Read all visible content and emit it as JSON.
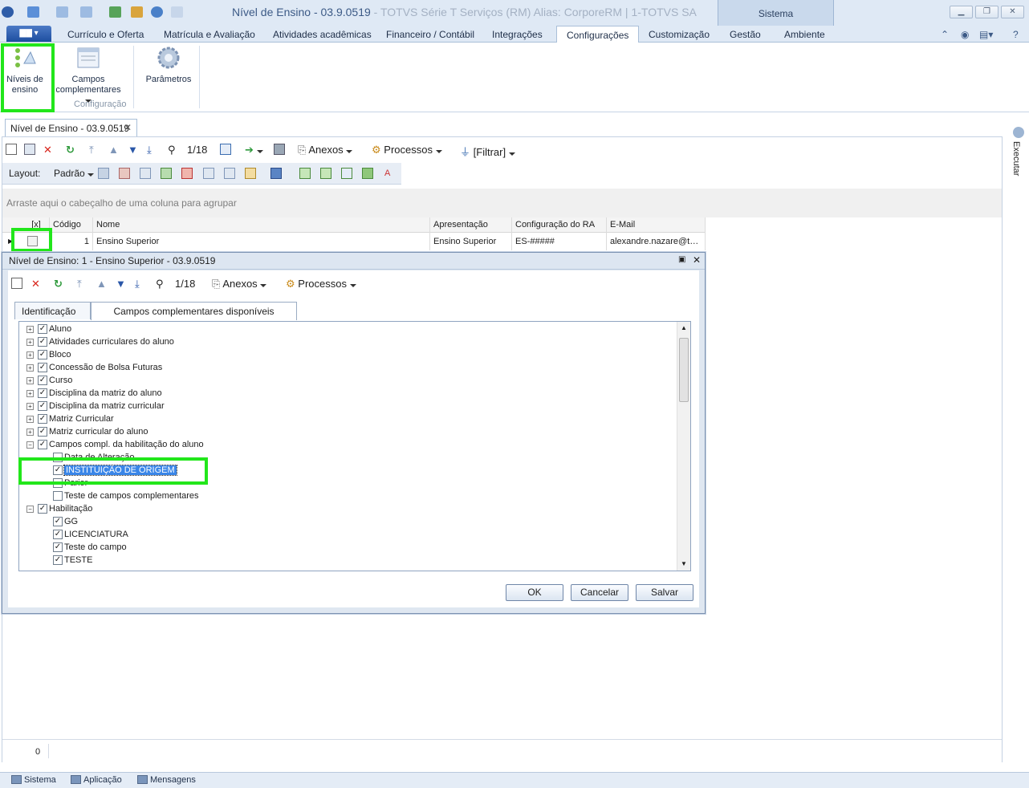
{
  "window": {
    "title_main": "Nível de Ensino - 03.9.0519",
    "title_sub": " - TOTVS Série T Serviços (RM) Alias: CorporeRM | 1-TOTVS SA",
    "sistema_label": "Sistema"
  },
  "menu": {
    "tabs": [
      "Currículo e Oferta",
      "Matrícula e Avaliação",
      "Atividades acadêmicas",
      "Financeiro / Contábil",
      "Integrações",
      "Configurações",
      "Customização",
      "Gestão",
      "Ambiente"
    ],
    "active": "Configurações"
  },
  "ribbon": {
    "niveis_label_1": "Níveis de",
    "niveis_label_2": "ensino",
    "campos_label_1": "Campos",
    "campos_label_2": "complementares",
    "group_label": "Configuração",
    "parametros_label": "Parâmetros"
  },
  "doc_tab": {
    "label": "Nível de Ensino - 03.9.0519"
  },
  "toolbar": {
    "record_counter": "1/18",
    "anexos": "Anexos",
    "processos": "Processos",
    "filtrar": "[Filtrar]"
  },
  "layoutbar": {
    "label": "Layout:",
    "padrao": "Padrão"
  },
  "grid": {
    "group_hint": "Arraste aqui o cabeçalho de uma coluna para agrupar",
    "columns": [
      "[x]",
      "Código",
      "Nome",
      "Apresentação",
      "Configuração do RA",
      "E-Mail"
    ],
    "rows": [
      {
        "codigo": "1",
        "nome": "Ensino Superior",
        "apresentacao": "Ensino Superior",
        "config_ra": "ES-#####",
        "email": "alexandre.nazare@t…"
      }
    ],
    "count": "0"
  },
  "side_panel": {
    "label": "Executar"
  },
  "dialog": {
    "title": "Nível de Ensino: 1 - Ensino Superior - 03.9.0519",
    "record_counter": "1/18",
    "anexos": "Anexos",
    "processos": "Processos",
    "tabs": [
      "Identificação",
      "Campos complementares disponíveis"
    ],
    "active_tab": "Campos complementares disponíveis",
    "tree": [
      {
        "label": "Aluno",
        "level": 0,
        "expander": "+",
        "checked": true
      },
      {
        "label": "Atividades curriculares do aluno",
        "level": 0,
        "expander": "+",
        "checked": true
      },
      {
        "label": "Bloco",
        "level": 0,
        "expander": "+",
        "checked": true
      },
      {
        "label": "Concessão de Bolsa Futuras",
        "level": 0,
        "expander": "+",
        "checked": true
      },
      {
        "label": "Curso",
        "level": 0,
        "expander": "+",
        "checked": true
      },
      {
        "label": "Disciplina da matriz do aluno",
        "level": 0,
        "expander": "+",
        "checked": true
      },
      {
        "label": "Disciplina da matriz curricular",
        "level": 0,
        "expander": "+",
        "checked": true
      },
      {
        "label": "Matriz Curricular",
        "level": 0,
        "expander": "+",
        "checked": true
      },
      {
        "label": "Matriz curricular do aluno",
        "level": 0,
        "expander": "+",
        "checked": true
      },
      {
        "label": "Campos compl. da habilitação do aluno",
        "level": 0,
        "expander": "−",
        "checked": true
      },
      {
        "label": "Data de Alteração",
        "level": 1,
        "expander": "",
        "checked": false
      },
      {
        "label": "INSTITUIÇÃO DE ORIGEM",
        "level": 1,
        "expander": "",
        "checked": true,
        "selected": true
      },
      {
        "label": "Parior",
        "level": 1,
        "expander": "",
        "checked": false
      },
      {
        "label": "Teste de campos complementares",
        "level": 1,
        "expander": "",
        "checked": false
      },
      {
        "label": "Habilitação",
        "level": 0,
        "expander": "−",
        "checked": true
      },
      {
        "label": "GG",
        "level": 1,
        "expander": "",
        "checked": true
      },
      {
        "label": "LICENCIATURA",
        "level": 1,
        "expander": "",
        "checked": true
      },
      {
        "label": "Teste do campo",
        "level": 1,
        "expander": "",
        "checked": true
      },
      {
        "label": "TESTE",
        "level": 1,
        "expander": "",
        "checked": true
      }
    ],
    "buttons": {
      "ok": "OK",
      "cancel": "Cancelar",
      "save": "Salvar"
    }
  },
  "bottom_bar": {
    "items": [
      "Sistema",
      "Aplicação",
      "Mensagens"
    ]
  },
  "colors": {
    "highlight": "#22e61b",
    "app_button": "#1d4e9f",
    "selection": "#3a86e8"
  }
}
